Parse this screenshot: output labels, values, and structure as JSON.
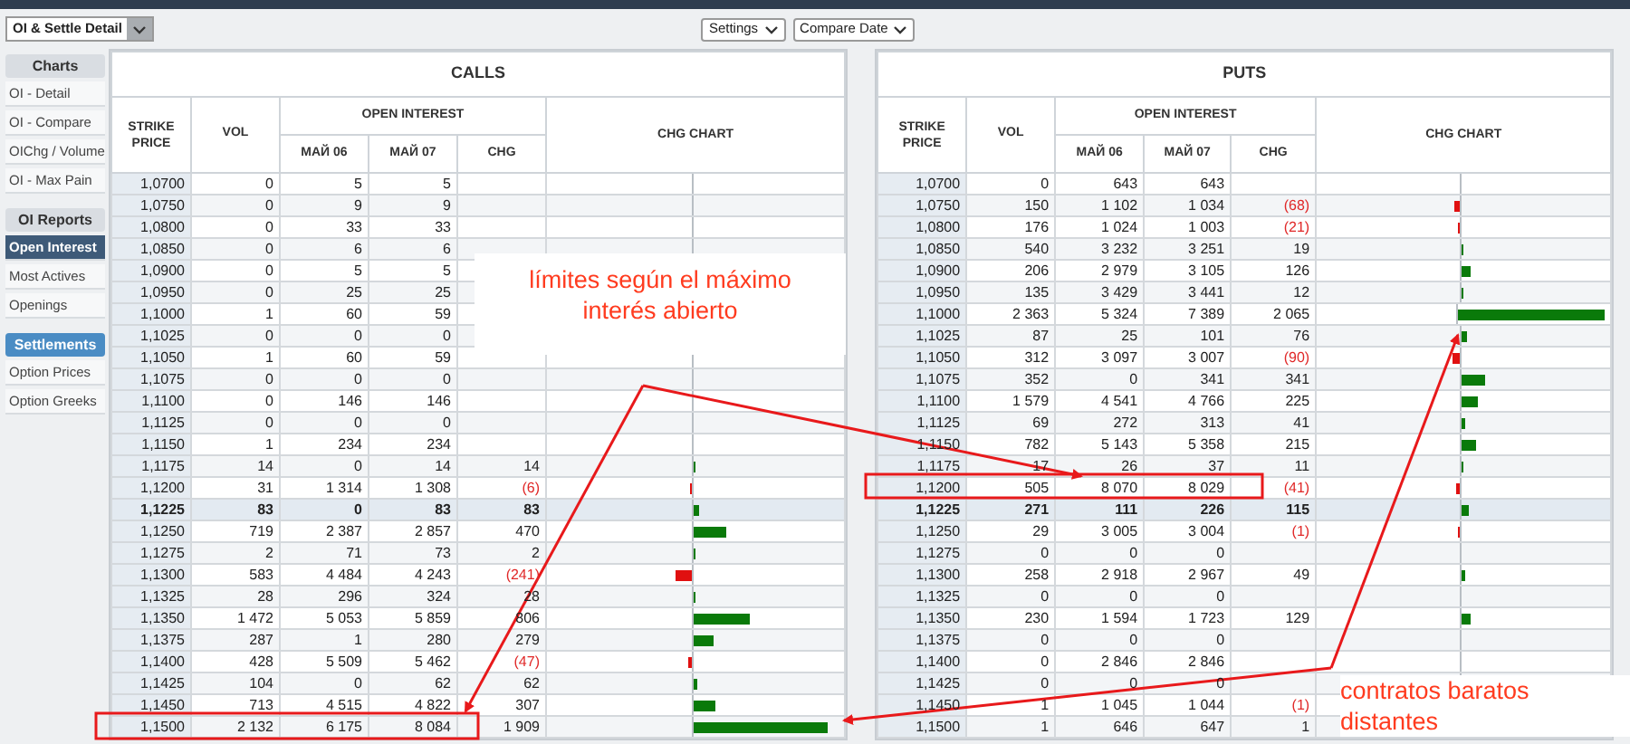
{
  "view_select": {
    "value": "OI & Settle Detail"
  },
  "toolbar": [
    "Settings",
    "Compare Date"
  ],
  "sidebar": [
    {
      "title": "Charts",
      "kind": "plain",
      "items": [
        {
          "label": "OI - Detail",
          "selected": false
        },
        {
          "label": "OI - Compare",
          "selected": false
        },
        {
          "label": "OIChg / Volume",
          "selected": false
        },
        {
          "label": "OI - Max Pain",
          "selected": false
        }
      ]
    },
    {
      "title": "OI Reports",
      "kind": "plain",
      "items": [
        {
          "label": "Open Interest",
          "selected": true
        },
        {
          "label": "Most Actives",
          "selected": false
        },
        {
          "label": "Openings",
          "selected": false
        }
      ]
    },
    {
      "title": "Settlements",
      "kind": "accent",
      "items": [
        {
          "label": "Option Prices",
          "selected": false
        },
        {
          "label": "Option Greeks",
          "selected": false
        }
      ]
    }
  ],
  "tables": [
    {
      "title": "CALLS",
      "headers": {
        "strike": "STRIKE PRICE",
        "vol": "VOL",
        "oi": "OPEN INTEREST",
        "oi_1": "МАЙ 06",
        "oi_2": "МАЙ 07",
        "chg": "CHG",
        "chart": "CHG CHART"
      },
      "rows": [
        {
          "strike": "1,0700",
          "vol": "0",
          "oi_1": "5",
          "oi_2": "5",
          "atm": false
        },
        {
          "strike": "1,0750",
          "vol": "0",
          "oi_1": "9",
          "oi_2": "9",
          "atm": false
        },
        {
          "strike": "1,0800",
          "vol": "0",
          "oi_1": "33",
          "oi_2": "33",
          "atm": false
        },
        {
          "strike": "1,0850",
          "vol": "0",
          "oi_1": "6",
          "oi_2": "6",
          "atm": false
        },
        {
          "strike": "1,0900",
          "vol": "0",
          "oi_1": "5",
          "oi_2": "5",
          "atm": false
        },
        {
          "strike": "1,0950",
          "vol": "0",
          "oi_1": "25",
          "oi_2": "25",
          "atm": false
        },
        {
          "strike": "1,1000",
          "vol": "1",
          "oi_1": "60",
          "oi_2": "59",
          "atm": false
        },
        {
          "strike": "1,1025",
          "vol": "0",
          "oi_1": "0",
          "oi_2": "0",
          "atm": false
        },
        {
          "strike": "1,1050",
          "vol": "1",
          "oi_1": "60",
          "oi_2": "59",
          "atm": false
        },
        {
          "strike": "1,1075",
          "vol": "0",
          "oi_1": "0",
          "oi_2": "0",
          "atm": false
        },
        {
          "strike": "1,1100",
          "vol": "0",
          "oi_1": "146",
          "oi_2": "146",
          "atm": false
        },
        {
          "strike": "1,1125",
          "vol": "0",
          "oi_1": "0",
          "oi_2": "0",
          "atm": false
        },
        {
          "strike": "1,1150",
          "vol": "1",
          "oi_1": "234",
          "oi_2": "234",
          "atm": false
        },
        {
          "strike": "1,1175",
          "vol": "14",
          "oi_1": "0",
          "oi_2": "14",
          "chg": "14",
          "kind": "gain",
          "atm": false
        },
        {
          "strike": "1,1200",
          "vol": "31",
          "oi_1": "1 314",
          "oi_2": "1 308",
          "chg": "(6)",
          "kind": "loss",
          "atm": false
        },
        {
          "strike": "1,1225",
          "vol": "83",
          "oi_1": "0",
          "oi_2": "83",
          "chg": "83",
          "kind": "gain",
          "atm": true
        },
        {
          "strike": "1,1250",
          "vol": "719",
          "oi_1": "2 387",
          "oi_2": "2 857",
          "chg": "470",
          "kind": "gain",
          "atm": false
        },
        {
          "strike": "1,1275",
          "vol": "2",
          "oi_1": "71",
          "oi_2": "73",
          "chg": "2",
          "kind": "gain",
          "atm": false
        },
        {
          "strike": "1,1300",
          "vol": "583",
          "oi_1": "4 484",
          "oi_2": "4 243",
          "chg": "(241)",
          "kind": "loss",
          "atm": false
        },
        {
          "strike": "1,1325",
          "vol": "28",
          "oi_1": "296",
          "oi_2": "324",
          "chg": "28",
          "kind": "gain",
          "atm": false
        },
        {
          "strike": "1,1350",
          "vol": "1 472",
          "oi_1": "5 053",
          "oi_2": "5 859",
          "chg": "806",
          "kind": "gain",
          "atm": false
        },
        {
          "strike": "1,1375",
          "vol": "287",
          "oi_1": "1",
          "oi_2": "280",
          "chg": "279",
          "kind": "gain",
          "atm": false
        },
        {
          "strike": "1,1400",
          "vol": "428",
          "oi_1": "5 509",
          "oi_2": "5 462",
          "chg": "(47)",
          "kind": "loss",
          "atm": false
        },
        {
          "strike": "1,1425",
          "vol": "104",
          "oi_1": "0",
          "oi_2": "62",
          "chg": "62",
          "kind": "gain",
          "atm": false
        },
        {
          "strike": "1,1450",
          "vol": "713",
          "oi_1": "4 515",
          "oi_2": "4 822",
          "chg": "307",
          "kind": "gain",
          "atm": false
        },
        {
          "strike": "1,1500",
          "vol": "2 132",
          "oi_1": "6 175",
          "oi_2": "8 084",
          "chg": "1 909",
          "kind": "gain",
          "atm": false
        }
      ]
    },
    {
      "title": "PUTS",
      "headers": {
        "strike": "STRIKE PRICE",
        "vol": "VOL",
        "oi": "OPEN INTEREST",
        "oi_1": "МАЙ 06",
        "oi_2": "МАЙ 07",
        "chg": "CHG",
        "chart": "CHG CHART"
      },
      "rows": [
        {
          "strike": "1,0700",
          "vol": "0",
          "oi_1": "643",
          "oi_2": "643",
          "atm": false
        },
        {
          "strike": "1,0750",
          "vol": "150",
          "oi_1": "1 102",
          "oi_2": "1 034",
          "chg": "(68)",
          "kind": "loss",
          "atm": false
        },
        {
          "strike": "1,0800",
          "vol": "176",
          "oi_1": "1 024",
          "oi_2": "1 003",
          "chg": "(21)",
          "kind": "loss",
          "atm": false
        },
        {
          "strike": "1,0850",
          "vol": "540",
          "oi_1": "3 232",
          "oi_2": "3 251",
          "chg": "19",
          "kind": "gain",
          "atm": false
        },
        {
          "strike": "1,0900",
          "vol": "206",
          "oi_1": "2 979",
          "oi_2": "3 105",
          "chg": "126",
          "kind": "gain",
          "atm": false
        },
        {
          "strike": "1,0950",
          "vol": "135",
          "oi_1": "3 429",
          "oi_2": "3 441",
          "chg": "12",
          "kind": "gain",
          "atm": false
        },
        {
          "strike": "1,1000",
          "vol": "2 363",
          "oi_1": "5 324",
          "oi_2": "7 389",
          "chg": "2 065",
          "kind": "gain",
          "atm": false
        },
        {
          "strike": "1,1025",
          "vol": "87",
          "oi_1": "25",
          "oi_2": "101",
          "chg": "76",
          "kind": "gain",
          "atm": false
        },
        {
          "strike": "1,1050",
          "vol": "312",
          "oi_1": "3 097",
          "oi_2": "3 007",
          "chg": "(90)",
          "kind": "loss",
          "atm": false
        },
        {
          "strike": "1,1075",
          "vol": "352",
          "oi_1": "0",
          "oi_2": "341",
          "chg": "341",
          "kind": "gain",
          "atm": false
        },
        {
          "strike": "1,1100",
          "vol": "1 579",
          "oi_1": "4 541",
          "oi_2": "4 766",
          "chg": "225",
          "kind": "gain",
          "atm": false
        },
        {
          "strike": "1,1125",
          "vol": "69",
          "oi_1": "272",
          "oi_2": "313",
          "chg": "41",
          "kind": "gain",
          "atm": false
        },
        {
          "strike": "1,1150",
          "vol": "782",
          "oi_1": "5 143",
          "oi_2": "5 358",
          "chg": "215",
          "kind": "gain",
          "atm": false
        },
        {
          "strike": "1,1175",
          "vol": "17",
          "oi_1": "26",
          "oi_2": "37",
          "chg": "11",
          "kind": "gain",
          "atm": false
        },
        {
          "strike": "1,1200",
          "vol": "505",
          "oi_1": "8 070",
          "oi_2": "8 029",
          "chg": "(41)",
          "kind": "loss",
          "atm": false
        },
        {
          "strike": "1,1225",
          "vol": "271",
          "oi_1": "111",
          "oi_2": "226",
          "chg": "115",
          "kind": "gain",
          "atm": true
        },
        {
          "strike": "1,1250",
          "vol": "29",
          "oi_1": "3 005",
          "oi_2": "3 004",
          "chg": "(1)",
          "kind": "loss",
          "atm": false
        },
        {
          "strike": "1,1275",
          "vol": "0",
          "oi_1": "0",
          "oi_2": "0",
          "atm": false
        },
        {
          "strike": "1,1300",
          "vol": "258",
          "oi_1": "2 918",
          "oi_2": "2 967",
          "chg": "49",
          "kind": "gain",
          "atm": false
        },
        {
          "strike": "1,1325",
          "vol": "0",
          "oi_1": "0",
          "oi_2": "0",
          "atm": false
        },
        {
          "strike": "1,1350",
          "vol": "230",
          "oi_1": "1 594",
          "oi_2": "1 723",
          "chg": "129",
          "kind": "gain",
          "atm": false
        },
        {
          "strike": "1,1375",
          "vol": "0",
          "oi_1": "0",
          "oi_2": "0",
          "atm": false
        },
        {
          "strike": "1,1400",
          "vol": "0",
          "oi_1": "2 846",
          "oi_2": "2 846",
          "atm": false
        },
        {
          "strike": "1,1425",
          "vol": "0",
          "oi_1": "0",
          "oi_2": "0",
          "atm": false
        },
        {
          "strike": "1,1450",
          "vol": "1",
          "oi_1": "1 045",
          "oi_2": "1 044",
          "chg": "(1)",
          "kind": "loss",
          "atm": false
        },
        {
          "strike": "1,1500",
          "vol": "1",
          "oi_1": "646",
          "oi_2": "647",
          "chg": "1",
          "kind": "gain",
          "atm": false
        }
      ]
    }
  ],
  "annotations": [
    "límites según el máximo interés abierto",
    "contratos baratos distantes"
  ]
}
